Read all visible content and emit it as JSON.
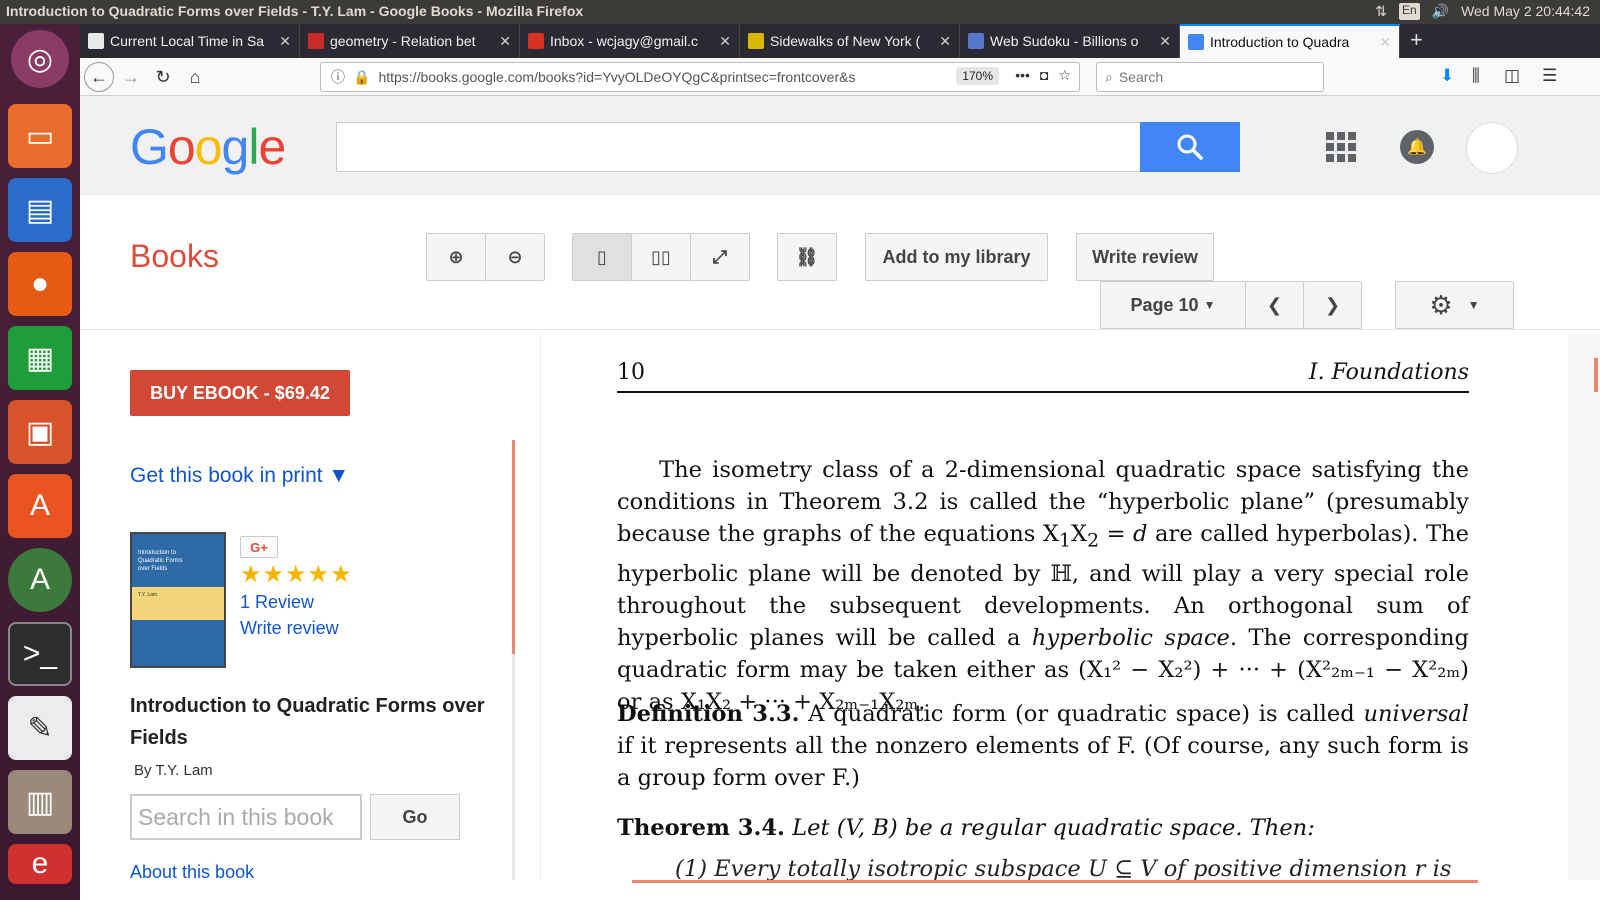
{
  "os": {
    "window_title": "Introduction to Quadratic Forms over Fields - T.Y. Lam - Google Books - Mozilla Firefox",
    "lang": "En",
    "clock": "Wed May  2 20:44:42"
  },
  "launcher": {
    "items": [
      "ubuntu-logo",
      "files",
      "writer",
      "firefox",
      "calc",
      "impress",
      "software-center",
      "software-updater",
      "terminal",
      "text-editor",
      "file-manager",
      "extra-app"
    ]
  },
  "tabs": [
    {
      "label": "Current Local Time in Sa",
      "fav_color": "#e8e8e8"
    },
    {
      "label": "geometry - Relation bet",
      "fav_color": "#cc2a2a"
    },
    {
      "label": "Inbox - wcjagy@gmail.c",
      "fav_color": "#d93025"
    },
    {
      "label": "Sidewalks of New York (",
      "fav_color": "#d8b800"
    },
    {
      "label": "Web Sudoku - Billions o",
      "fav_color": "#5577cc"
    },
    {
      "label": "Introduction to Quadra",
      "fav_color": "#4285f4"
    }
  ],
  "nav": {
    "url": "https://books.google.com/books?id=YvyOLDeOYQgC&printsec=frontcover&s",
    "zoom": "170%",
    "search_placeholder": "Search"
  },
  "google": {
    "logo": "Google"
  },
  "books": {
    "label": "Books",
    "add_library": "Add to my library",
    "write_review": "Write review",
    "page_select": "Page 10"
  },
  "sidebar": {
    "buy": "BUY EBOOK - $69.42",
    "get_print": "Get this book in print ▼",
    "gplus": "G+",
    "stars": "★★★★★",
    "reviews": "1 Review",
    "write_review": "Write review",
    "title": "Introduction to Quadratic Forms over Fields",
    "author": "By T.Y. Lam",
    "search_placeholder": "Search in this book",
    "go": "Go",
    "about": "About this book"
  },
  "page": {
    "number": "10",
    "header": "I. Foundations",
    "para1_a": "The isometry class of a 2-dimensional quadratic space satisfying the conditions in Theorem 3.2 is called the “hyperbolic plane” (presumably because the graphs of the equations X",
    "para1_b": " are called hyperbolas). The hyperbolic plane will be denoted by ℍ, and will play a very special role throughout the subsequent developments. An orthogonal sum of hyperbolic planes will be called a ",
    "para1_hyp": "hyperbolic space",
    "para1_c": ". The corresponding quadratic form may be taken either as (X₁² − X₂²) + ··· + (X²₂ₘ₋₁ − X²₂ₘ) or as X₁X₂ + ··· + X₂ₘ₋₁X₂ₘ.",
    "def_label": "Definition 3.3.",
    "def_text_a": " A quadratic form (or quadratic space) is called ",
    "def_universal": "universal",
    "def_text_b": " if it represents all the nonzero elements of F. (Of course, any such form is a group form over F.)",
    "thm_label": "Theorem 3.4.",
    "thm_text": " Let (V, B) be a regular quadratic space. Then:",
    "item1": "(1)  Every totally isotropic subspace U ⊆ V of positive dimension r is"
  }
}
